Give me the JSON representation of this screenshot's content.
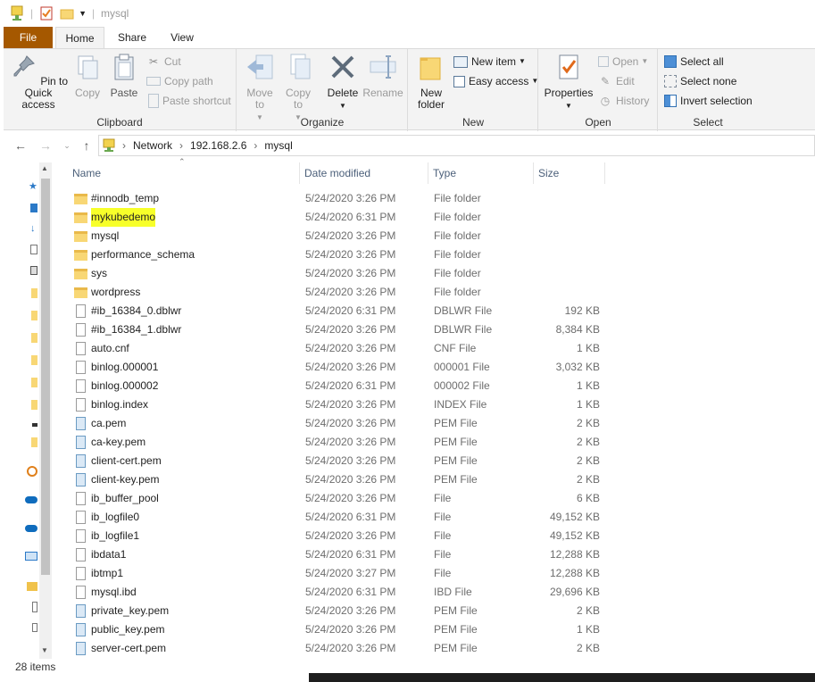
{
  "window": {
    "title": "mysql"
  },
  "ribbon_tabs": [
    "File",
    "Home",
    "Share",
    "View"
  ],
  "clipboard": {
    "label": "Clipboard",
    "pin": "Pin to Quick access",
    "copy": "Copy",
    "paste": "Paste",
    "cut": "Cut",
    "copy_path": "Copy path",
    "paste_shortcut": "Paste shortcut"
  },
  "organize": {
    "label": "Organize",
    "move_to": "Move to",
    "copy_to": "Copy to",
    "delete": "Delete",
    "rename": "Rename"
  },
  "new": {
    "label": "New",
    "new_folder": "New folder",
    "new_item": "New item",
    "easy_access": "Easy access"
  },
  "open": {
    "label": "Open",
    "properties": "Properties",
    "open": "Open",
    "edit": "Edit",
    "history": "History"
  },
  "select": {
    "label": "Select",
    "select_all": "Select all",
    "select_none": "Select none",
    "invert_selection": "Invert selection"
  },
  "breadcrumb": [
    "Network",
    "192.168.2.6",
    "mysql"
  ],
  "columns": {
    "name": "Name",
    "date": "Date modified",
    "type": "Type",
    "size": "Size"
  },
  "files": [
    {
      "name": "#innodb_temp",
      "date": "5/24/2020 3:26 PM",
      "type": "File folder",
      "size": "",
      "icon": "folder"
    },
    {
      "name": "mykubedemo",
      "date": "5/24/2020 6:31 PM",
      "type": "File folder",
      "size": "",
      "icon": "folder"
    },
    {
      "name": "mysql",
      "date": "5/24/2020 3:26 PM",
      "type": "File folder",
      "size": "",
      "icon": "folder"
    },
    {
      "name": "performance_schema",
      "date": "5/24/2020 3:26 PM",
      "type": "File folder",
      "size": "",
      "icon": "folder"
    },
    {
      "name": "sys",
      "date": "5/24/2020 3:26 PM",
      "type": "File folder",
      "size": "",
      "icon": "folder"
    },
    {
      "name": "wordpress",
      "date": "5/24/2020 3:26 PM",
      "type": "File folder",
      "size": "",
      "icon": "folder"
    },
    {
      "name": "#ib_16384_0.dblwr",
      "date": "5/24/2020 6:31 PM",
      "type": "DBLWR File",
      "size": "192 KB",
      "icon": "doc"
    },
    {
      "name": "#ib_16384_1.dblwr",
      "date": "5/24/2020 3:26 PM",
      "type": "DBLWR File",
      "size": "8,384 KB",
      "icon": "doc"
    },
    {
      "name": "auto.cnf",
      "date": "5/24/2020 3:26 PM",
      "type": "CNF File",
      "size": "1 KB",
      "icon": "doc"
    },
    {
      "name": "binlog.000001",
      "date": "5/24/2020 3:26 PM",
      "type": "000001 File",
      "size": "3,032 KB",
      "icon": "doc"
    },
    {
      "name": "binlog.000002",
      "date": "5/24/2020 6:31 PM",
      "type": "000002 File",
      "size": "1 KB",
      "icon": "doc"
    },
    {
      "name": "binlog.index",
      "date": "5/24/2020 3:26 PM",
      "type": "INDEX File",
      "size": "1 KB",
      "icon": "doc"
    },
    {
      "name": "ca.pem",
      "date": "5/24/2020 3:26 PM",
      "type": "PEM File",
      "size": "2 KB",
      "icon": "pem"
    },
    {
      "name": "ca-key.pem",
      "date": "5/24/2020 3:26 PM",
      "type": "PEM File",
      "size": "2 KB",
      "icon": "pem"
    },
    {
      "name": "client-cert.pem",
      "date": "5/24/2020 3:26 PM",
      "type": "PEM File",
      "size": "2 KB",
      "icon": "pem"
    },
    {
      "name": "client-key.pem",
      "date": "5/24/2020 3:26 PM",
      "type": "PEM File",
      "size": "2 KB",
      "icon": "pem"
    },
    {
      "name": "ib_buffer_pool",
      "date": "5/24/2020 3:26 PM",
      "type": "File",
      "size": "6 KB",
      "icon": "doc"
    },
    {
      "name": "ib_logfile0",
      "date": "5/24/2020 6:31 PM",
      "type": "File",
      "size": "49,152 KB",
      "icon": "doc"
    },
    {
      "name": "ib_logfile1",
      "date": "5/24/2020 3:26 PM",
      "type": "File",
      "size": "49,152 KB",
      "icon": "doc"
    },
    {
      "name": "ibdata1",
      "date": "5/24/2020 6:31 PM",
      "type": "File",
      "size": "12,288 KB",
      "icon": "doc"
    },
    {
      "name": "ibtmp1",
      "date": "5/24/2020 3:27 PM",
      "type": "File",
      "size": "12,288 KB",
      "icon": "doc"
    },
    {
      "name": "mysql.ibd",
      "date": "5/24/2020 6:31 PM",
      "type": "IBD File",
      "size": "29,696 KB",
      "icon": "doc"
    },
    {
      "name": "private_key.pem",
      "date": "5/24/2020 3:26 PM",
      "type": "PEM File",
      "size": "2 KB",
      "icon": "pem"
    },
    {
      "name": "public_key.pem",
      "date": "5/24/2020 3:26 PM",
      "type": "PEM File",
      "size": "1 KB",
      "icon": "pem"
    },
    {
      "name": "server-cert.pem",
      "date": "5/24/2020 3:26 PM",
      "type": "PEM File",
      "size": "2 KB",
      "icon": "pem"
    }
  ],
  "highlighted_file": "mykubedemo",
  "status": {
    "item_count": "28 items"
  },
  "colors": {
    "file_tab": "#a55800",
    "highlight": "#f7ff2a",
    "folder": "#f8d775"
  }
}
